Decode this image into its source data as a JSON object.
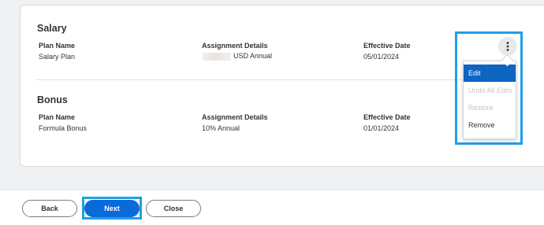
{
  "salary": {
    "title": "Salary",
    "headers": [
      "Plan Name",
      "Assignment Details",
      "Effective Date"
    ],
    "values": [
      "Salary Plan",
      "USD Annual",
      "05/01/2024"
    ]
  },
  "bonus": {
    "title": "Bonus",
    "headers": [
      "Plan Name",
      "Assignment Details",
      "Effective Date"
    ],
    "values": [
      "Formula Bonus",
      "10% Annual",
      "01/01/2024"
    ]
  },
  "menu": {
    "items": [
      "Edit",
      "Undo All Edits",
      "Restore",
      "Remove"
    ]
  },
  "footer": {
    "back": "Back",
    "next": "Next",
    "close": "Close"
  },
  "colors": {
    "primary": "#0b6ad9",
    "highlight": "#1e9fe8",
    "menu_active": "#0d65c2"
  },
  "icons": {
    "kebab": "more-vertical-icon"
  }
}
